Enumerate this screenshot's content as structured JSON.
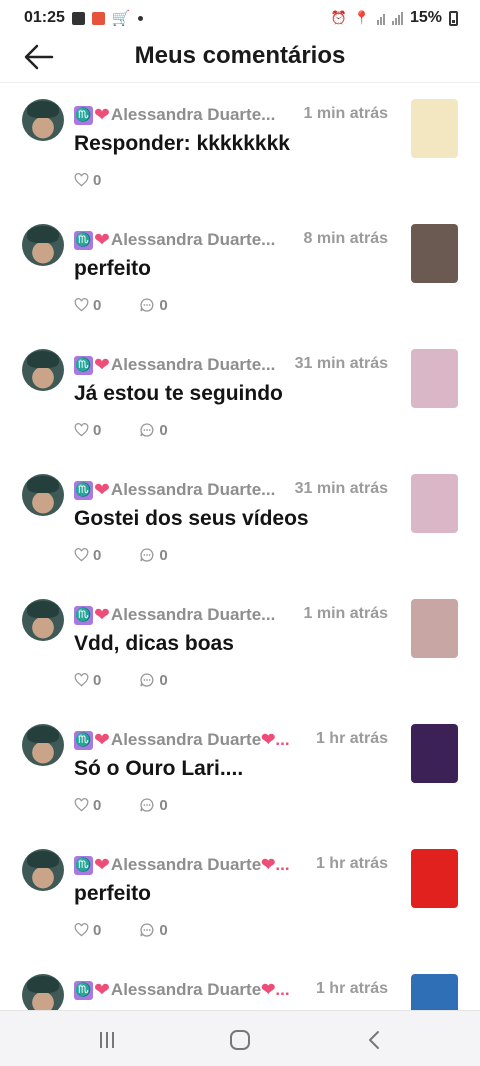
{
  "status_bar": {
    "time": "01:25",
    "battery": "15%"
  },
  "header": {
    "title": "Meus comentários"
  },
  "comments": [
    {
      "badge": "♏",
      "username": "Alessandra Duarte...",
      "time": "1 min atrás",
      "text": "Responder: kkkkkkkk",
      "likes": "0",
      "replies": null,
      "thumb_color": "#f3e7c2"
    },
    {
      "badge": "♏",
      "username": "Alessandra Duarte...",
      "time": "8 min atrás",
      "text": "perfeito",
      "likes": "0",
      "replies": "0",
      "thumb_color": "#6b5a52"
    },
    {
      "badge": "♏",
      "username": "Alessandra Duarte...",
      "time": "31 min atrás",
      "text": "Já estou te seguindo",
      "likes": "0",
      "replies": "0",
      "thumb_color": "#d9b7c6"
    },
    {
      "badge": "♏",
      "username": "Alessandra Duarte...",
      "time": "31 min atrás",
      "text": "Gostei dos seus vídeos",
      "likes": "0",
      "replies": "0",
      "thumb_color": "#d9b7c6"
    },
    {
      "badge": "♏",
      "username": "Alessandra Duarte...",
      "time": "1 min atrás",
      "text": "Vdd, dicas boas",
      "likes": "0",
      "replies": "0",
      "thumb_color": "#c7a6a4"
    },
    {
      "badge": "♏",
      "username": "Alessandra Duarte",
      "username_suffix": "❤...",
      "time": "1 hr atrás",
      "text": "Só o Ouro Lari....",
      "likes": "0",
      "replies": "0",
      "thumb_color": "#3b2156"
    },
    {
      "badge": "♏",
      "username": "Alessandra Duarte",
      "username_suffix": "❤...",
      "time": "1 hr atrás",
      "text": "perfeito",
      "likes": "0",
      "replies": "0",
      "thumb_color": "#e0211e"
    },
    {
      "badge": "♏",
      "username": "Alessandra Duarte",
      "username_suffix": "❤...",
      "time": "1 hr atrás",
      "text": "",
      "likes": "",
      "replies": null,
      "thumb_color": "#2f6fb6"
    }
  ],
  "colors": {
    "accent_heart": "#ee4d78",
    "badge": "#a879e0",
    "muted": "#8e8e8e"
  }
}
